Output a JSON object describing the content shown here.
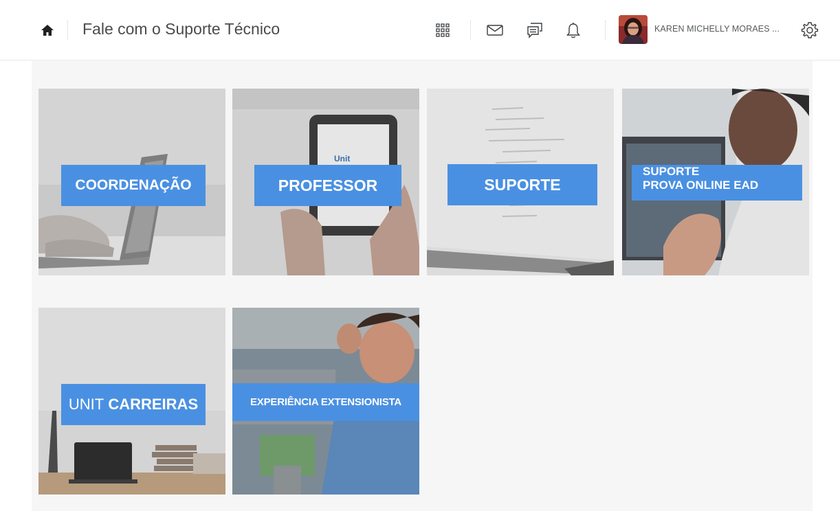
{
  "header": {
    "title": "Fale com o Suporte Técnico",
    "user_name": "KAREN MICHELLY MORAES ..."
  },
  "icons": {
    "home": "home-icon",
    "apps": "grid-icon",
    "mail": "mail-icon",
    "chat": "chat-icon",
    "notifications": "bell-icon",
    "settings": "gear-icon"
  },
  "tiles": [
    {
      "label": "COORDENAÇÃO"
    },
    {
      "label": "PROFESSOR"
    },
    {
      "label": "SUPORTE"
    },
    {
      "label_line1": "SUPORTE",
      "label_line2": "PROVA ONLINE EAD"
    },
    {
      "label_light": "UNIT",
      "label_bold": "CARREIRAS"
    },
    {
      "label": "EXPERIÊNCIA EXTENSIONISTA"
    }
  ],
  "tablet_brand": "Unit",
  "colors": {
    "accent": "#4a90e2",
    "text": "#494c4e",
    "background": "#f6f6f6"
  }
}
